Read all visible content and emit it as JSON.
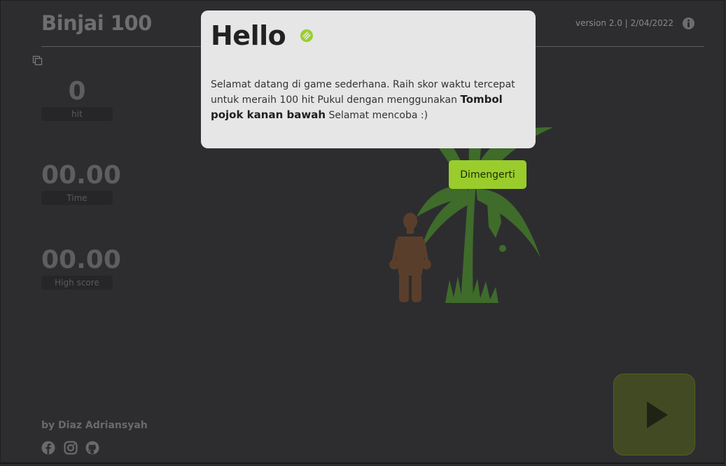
{
  "header": {
    "brand": "Binjai 100",
    "version": "version 2.0 | 2/04/2022"
  },
  "stats": [
    {
      "value": "0",
      "label": "hit"
    },
    {
      "value": "00.00",
      "label": "Time"
    },
    {
      "value": "00.00",
      "label": "High score"
    }
  ],
  "footer": {
    "author": "by Diaz Adriansyah",
    "social": [
      "facebook-icon",
      "instagram-icon",
      "github-icon"
    ]
  },
  "modal": {
    "title": "Hello",
    "body_start": "Selamat datang di game sederhana. Raih skor waktu tercepat untuk meraih 100 hit Pukul dengan menggunakan ",
    "body_bold": "Tombol pojok kanan bawah",
    "body_end": " Selamat mencoba :)",
    "confirm_label": "Dimengerti"
  },
  "colors": {
    "background": "#2d2d30",
    "accent": "#9acd2c",
    "play_button": "#414a23",
    "tree": "#3f6b2b",
    "character": "#5a3e2c"
  },
  "icons": {
    "info": "info-icon",
    "copy": "copy-icon",
    "play": "play-icon",
    "wave": "waving-hand-icon"
  }
}
